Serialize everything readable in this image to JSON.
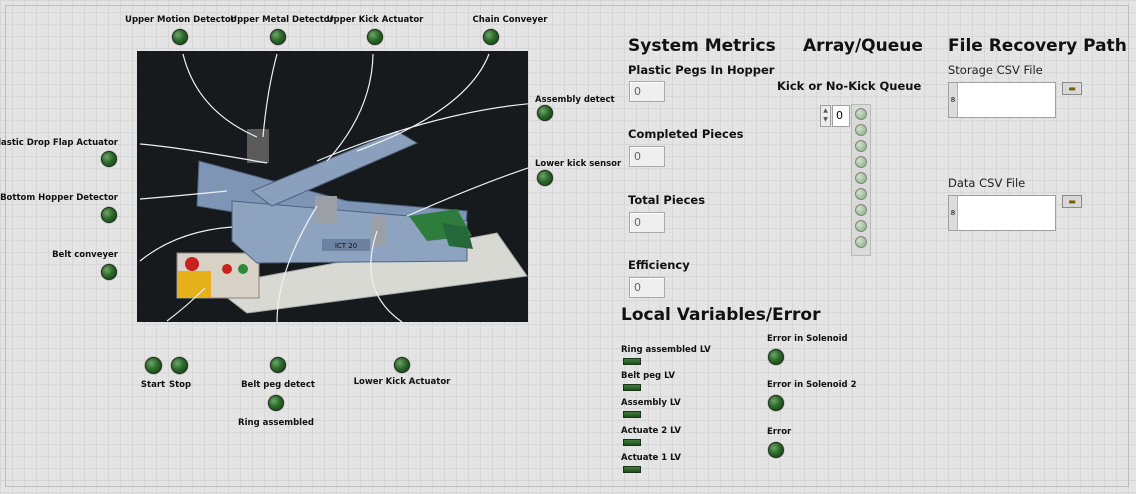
{
  "top_indicators": {
    "upper_motion_detector": "Upper Motion Detector",
    "upper_metal_detector": "Upper Metal Detector",
    "upper_kick_actuator": "Upper Kick Actuator",
    "chain_conveyer": "Chain Conveyer"
  },
  "left_indicators": {
    "plastic_drop_flap_actuator": "Plastic Drop Flap Actuator",
    "bottom_hopper_detector": "Bottom Hopper Detector",
    "belt_conveyer": "Belt conveyer"
  },
  "right_indicators": {
    "assembly_detect": "Assembly detect",
    "lower_kick_sensor": "Lower kick sensor"
  },
  "bottom_indicators": {
    "start": "Start",
    "stop": "Stop",
    "belt_peg_detect": "Belt peg detect",
    "ring_assembled": "Ring assembled",
    "lower_kick_actuator": "Lower Kick Actuator"
  },
  "photo": {
    "plate_label": "ICT 20"
  },
  "system_metrics": {
    "title": "System Metrics",
    "plastic_pegs_label": "Plastic Pegs In Hopper",
    "plastic_pegs_value": "0",
    "completed_label": "Completed Pieces",
    "completed_value": "0",
    "total_label": "Total Pieces",
    "total_value": "0",
    "efficiency_label": "Efficiency",
    "efficiency_value": "0"
  },
  "array_queue": {
    "title": "Array/Queue",
    "queue_label": "Kick or No-Kick Queue",
    "index_value": "0"
  },
  "file_recovery": {
    "title": "File Recovery Path",
    "storage_label": "Storage CSV File",
    "data_label": "Data CSV File",
    "path_tag": "8"
  },
  "local_variables": {
    "title": "Local Variables/Error",
    "ring_assembled_lv": "Ring assembled LV",
    "belt_peg_lv": "Belt peg LV",
    "assembly_lv": "Assembly LV",
    "actuate2_lv": "Actuate 2 LV",
    "actuate1_lv": "Actuate 1 LV",
    "error_solenoid": "Error in Solenoid",
    "error_solenoid2": "Error in Solenoid 2",
    "error": "Error"
  },
  "colors": {
    "led_on": "#2c6a2a",
    "background": "#e4e4e4",
    "photo_bg": "#161a1d",
    "machine_blue": "#7e95b5"
  }
}
